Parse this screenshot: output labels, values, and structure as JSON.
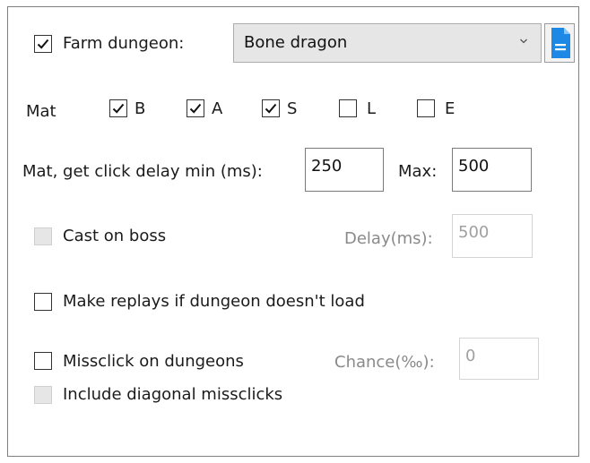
{
  "farm": {
    "label": "Farm dungeon:",
    "checked": true,
    "selected": "Bone dragon"
  },
  "mat": {
    "label": "Mat",
    "options": [
      {
        "label": "B",
        "checked": true
      },
      {
        "label": "A",
        "checked": true
      },
      {
        "label": "S",
        "checked": true
      },
      {
        "label": "L",
        "checked": false
      },
      {
        "label": "E",
        "checked": false
      }
    ]
  },
  "click_delay": {
    "label": "Mat, get click delay min (ms):",
    "min_value": "250",
    "max_label": "Max:",
    "max_value": "500"
  },
  "cast_on_boss": {
    "label": "Cast on boss",
    "checked": false,
    "enabled": false,
    "delay_label": "Delay(ms):",
    "delay_value": "500"
  },
  "make_replays": {
    "label": "Make replays if dungeon doesn't load",
    "checked": false
  },
  "missclick": {
    "label": "Missclick on dungeons",
    "checked": false,
    "chance_label": "Chance(‰):",
    "chance_value": "0"
  },
  "diagonal": {
    "label": "Include diagonal missclicks",
    "checked": false,
    "enabled": false
  },
  "colors": {
    "accent": "#1e88e5",
    "border": "#7f7f7f",
    "disabled_text": "#8a8a8a"
  },
  "icons": {
    "dropdown": "chevron-down-icon",
    "document": "document-icon",
    "check": "checkmark-icon"
  }
}
